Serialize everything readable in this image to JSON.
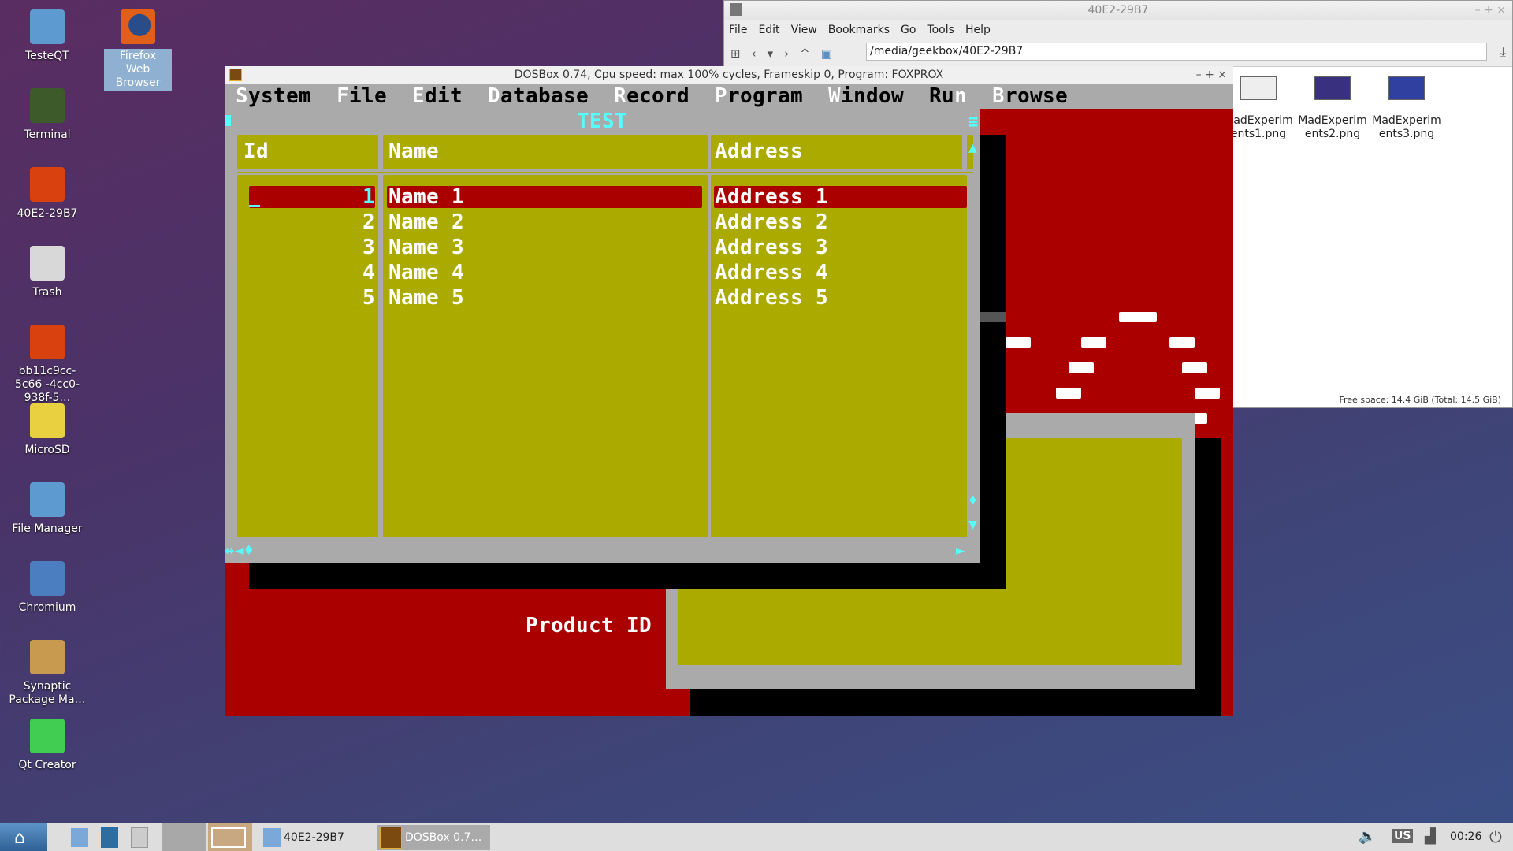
{
  "desktop": {
    "icons": [
      {
        "label": "TesteQT",
        "icon": "folder-icon",
        "color": "#5d9ad0"
      },
      {
        "label": "Terminal",
        "icon": "terminal-icon",
        "color": "#3c5a2a"
      },
      {
        "label": "40E2-29B7",
        "icon": "usb-drive-icon",
        "color": "#d9410f"
      },
      {
        "label": "Trash",
        "icon": "trash-icon",
        "color": "#d8d8d8"
      },
      {
        "label": "bb11c9cc-5c66 -4cc0-938f-5…",
        "icon": "usb-drive-icon",
        "color": "#d9410f"
      },
      {
        "label": "MicroSD",
        "icon": "sd-card-icon",
        "color": "#e8d040"
      },
      {
        "label": "File Manager",
        "icon": "file-manager-icon",
        "color": "#5d9ad0"
      },
      {
        "label": "Chromium",
        "icon": "chromium-icon",
        "color": "#4a7ec0"
      },
      {
        "label": "Synaptic Package Ma…",
        "icon": "synaptic-icon",
        "color": "#c89a50"
      },
      {
        "label": "Qt Creator",
        "icon": "qt-creator-icon",
        "color": "#41cd52"
      }
    ],
    "firefox": {
      "label": "Firefox Web Browser",
      "icon": "firefox-icon",
      "color": "#e0601a"
    }
  },
  "file_manager": {
    "title": "40E2-29B7",
    "menu": [
      "File",
      "Edit",
      "View",
      "Bookmarks",
      "Go",
      "Tools",
      "Help"
    ],
    "path": "/media/geekbox/40E2-29B7",
    "files": [
      "MadExperiments1.png",
      "MadExperiments2.png",
      "MadExperiments3.png"
    ],
    "status": "Free space: 14.4 GiB (Total: 14.5 GiB)"
  },
  "dosbox": {
    "title": "DOSBox 0.74, Cpu speed: max 100% cycles, Frameskip  0, Program:  FOXPROX",
    "menu": [
      {
        "label": "System",
        "hotkey": 0
      },
      {
        "label": "File",
        "hotkey": 0
      },
      {
        "label": "Edit",
        "hotkey": 0
      },
      {
        "label": "Database",
        "hotkey": 0
      },
      {
        "label": "Record",
        "hotkey": 0
      },
      {
        "label": "Program",
        "hotkey": 0
      },
      {
        "label": "Window",
        "hotkey": 0
      },
      {
        "label": "Run",
        "hotkey": 2
      },
      {
        "label": "Browse",
        "hotkey": 0
      }
    ],
    "browse_title": "TEST",
    "columns": [
      "Id",
      "Name",
      "Address"
    ],
    "rows": [
      {
        "id": "1",
        "name": "Name 1",
        "address": "Address 1"
      },
      {
        "id": "2",
        "name": "Name 2",
        "address": "Address 2"
      },
      {
        "id": "3",
        "name": "Name 3",
        "address": "Address 3"
      },
      {
        "id": "4",
        "name": "Name 4",
        "address": "Address 4"
      },
      {
        "id": "5",
        "name": "Name 5",
        "address": "Address 5"
      }
    ],
    "selected_row": 0,
    "field_label": "Product ID",
    "colors": {
      "gray": "#aaaaaa",
      "olive": "#aaaa00",
      "red": "#aa0000",
      "cyan": "#55ffff"
    }
  },
  "taskbar": {
    "tasks": [
      "40E2-29B7",
      "DOSBox 0.7…"
    ],
    "keyboard": "US",
    "clock": "00:26"
  }
}
